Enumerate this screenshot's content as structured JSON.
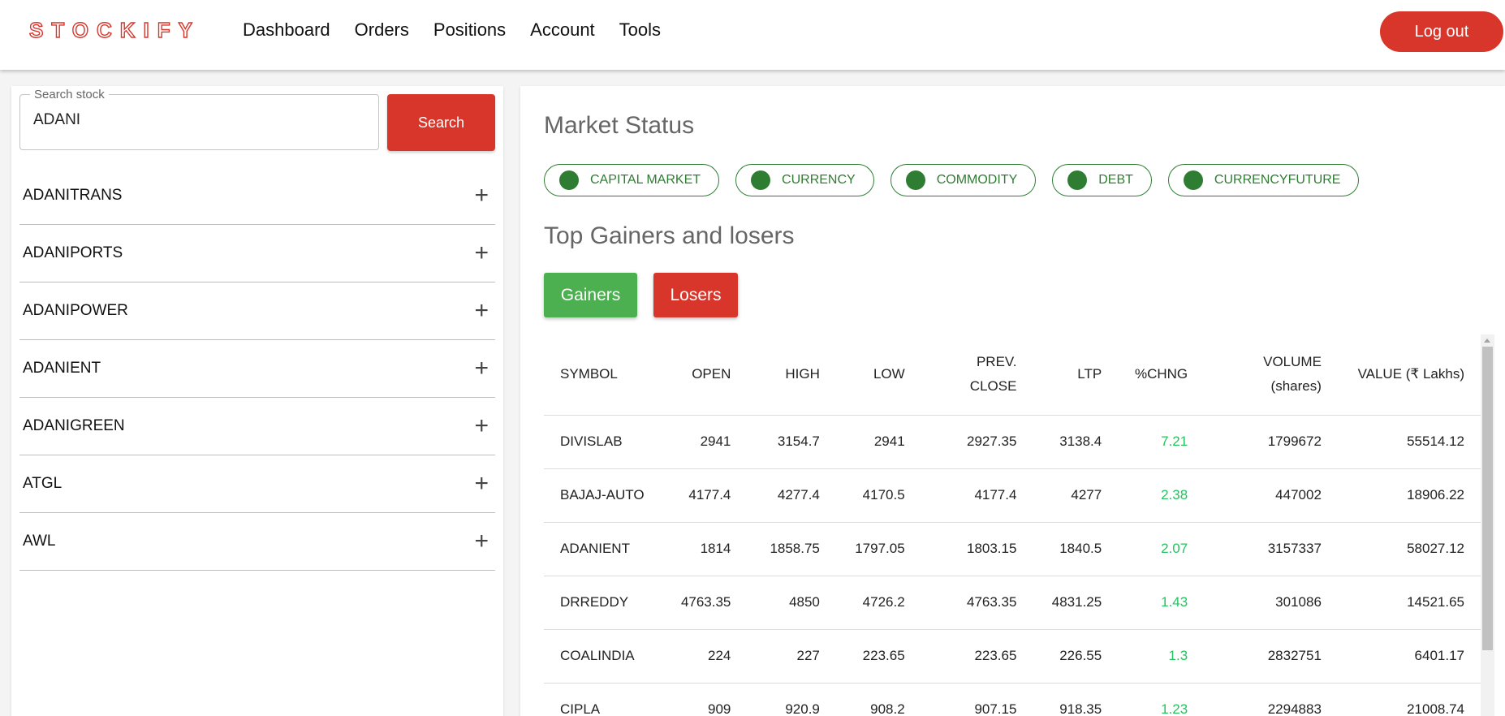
{
  "brand": {
    "logo_text": "STOCKIFY",
    "accent_color": "#d9362b",
    "success_color": "#2e7d32"
  },
  "nav": {
    "links": [
      "Dashboard",
      "Orders",
      "Positions",
      "Account",
      "Tools"
    ],
    "logout_label": "Log out"
  },
  "search": {
    "legend": "Search stock",
    "value": "ADANI",
    "button_label": "Search",
    "results": [
      "ADANITRANS",
      "ADANIPORTS",
      "ADANIPOWER",
      "ADANIENT",
      "ADANIGREEN",
      "ATGL",
      "AWL"
    ],
    "expand_icon": "plus-icon"
  },
  "market_status": {
    "title": "Market Status",
    "markets": [
      "CAPITAL MARKET",
      "CURRENCY",
      "COMMODITY",
      "DEBT",
      "CURRENCYFUTURE"
    ]
  },
  "gainers_losers": {
    "title": "Top Gainers and losers",
    "gainers_label": "Gainers",
    "losers_label": "Losers",
    "columns": [
      "SYMBOL",
      "OPEN",
      "HIGH",
      "LOW",
      "PREV. CLOSE",
      "LTP",
      "%CHNG",
      "VOLUME (shares)",
      "VALUE (₹ Lakhs)"
    ],
    "rows": [
      [
        "DIVISLAB",
        "2941",
        "3154.7",
        "2941",
        "2927.35",
        "3138.4",
        "7.21",
        "1799672",
        "55514.12"
      ],
      [
        "BAJAJ-AUTO",
        "4177.4",
        "4277.4",
        "4170.5",
        "4177.4",
        "4277",
        "2.38",
        "447002",
        "18906.22"
      ],
      [
        "ADANIENT",
        "1814",
        "1858.75",
        "1797.05",
        "1803.15",
        "1840.5",
        "2.07",
        "3157337",
        "58027.12"
      ],
      [
        "DRREDDY",
        "4763.35",
        "4850",
        "4726.2",
        "4763.35",
        "4831.25",
        "1.43",
        "301086",
        "14521.65"
      ],
      [
        "COALINDIA",
        "224",
        "227",
        "223.65",
        "223.65",
        "226.55",
        "1.3",
        "2832751",
        "6401.17"
      ],
      [
        "CIPLA",
        "909",
        "920.9",
        "908.2",
        "907.15",
        "918.35",
        "1.23",
        "2294883",
        "21008.74"
      ]
    ]
  }
}
